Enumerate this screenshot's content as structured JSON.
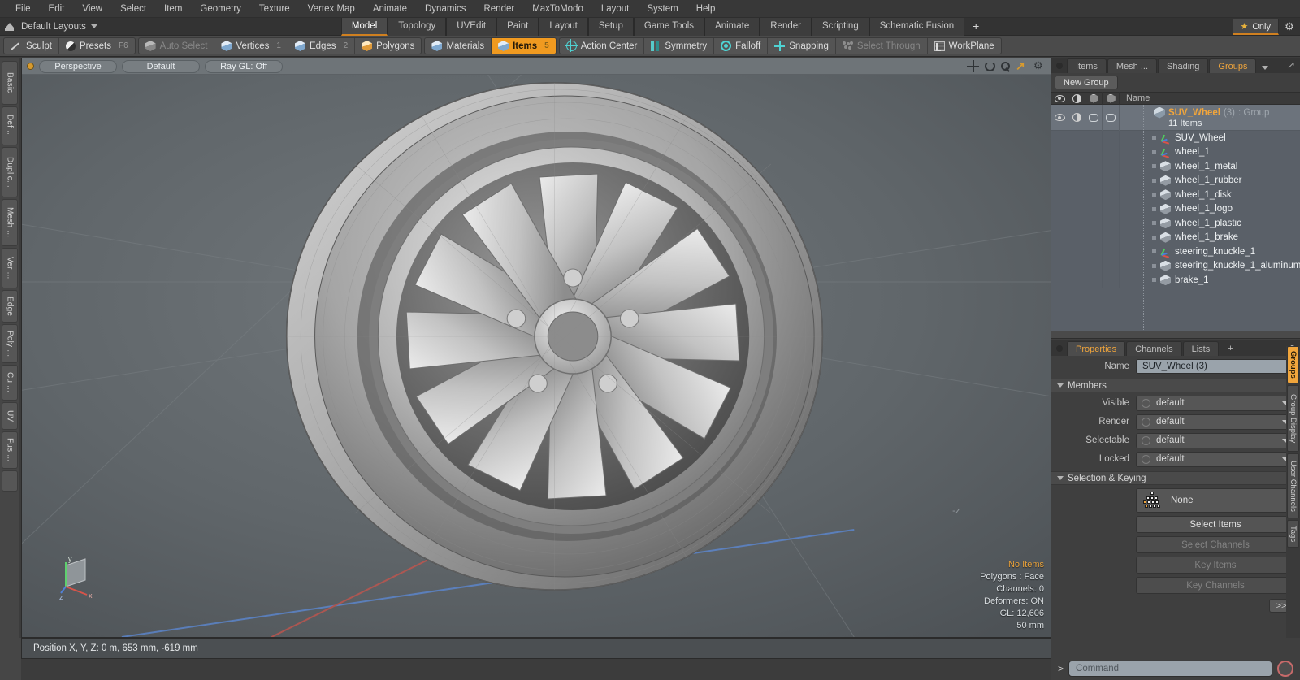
{
  "menu": {
    "items": [
      "File",
      "Edit",
      "View",
      "Select",
      "Item",
      "Geometry",
      "Texture",
      "Vertex Map",
      "Animate",
      "Dynamics",
      "Render",
      "MaxToModo",
      "Layout",
      "System",
      "Help"
    ]
  },
  "layout_row": {
    "home_icon": "home-icon",
    "layout_name": "Default Layouts",
    "tabs": [
      "Model",
      "Topology",
      "UVEdit",
      "Paint",
      "Layout",
      "Setup",
      "Game Tools",
      "Animate",
      "Render",
      "Scripting",
      "Schematic Fusion"
    ],
    "active_tab": "Model",
    "plus_label": "+",
    "only_label": "Only",
    "star_icon": "star-icon",
    "gear_icon": "gear-icon",
    "accent_color": "#d08020"
  },
  "modebar": {
    "sculpt": "Sculpt",
    "presets": "Presets",
    "presets_shortcut": "F6",
    "auto_select": "Auto Select",
    "vertices": "Vertices",
    "vertices_num": "1",
    "edges": "Edges",
    "edges_num": "2",
    "polygons": "Polygons",
    "materials": "Materials",
    "items": "Items",
    "items_num": "5",
    "action_center": "Action Center",
    "symmetry": "Symmetry",
    "falloff": "Falloff",
    "snapping": "Snapping",
    "select_through": "Select Through",
    "workplane": "WorkPlane",
    "active_color": "#f09a20"
  },
  "left_tabs": [
    "Basic",
    "Def ...",
    "Duplic...",
    "Mesh ...",
    "Ver ...",
    "Edge",
    "Poly ...",
    "Cu ...",
    "UV",
    "Fus ..."
  ],
  "viewport": {
    "projection": "Perspective",
    "shading": "Default",
    "raygl": "Ray GL: Off",
    "icons": [
      "move-icon",
      "rotate-icon",
      "zoom-icon",
      "fit-icon",
      "viewport-gear-icon"
    ],
    "stats": {
      "no_items": "No Items",
      "polygons": "Polygons : Face",
      "channels": "Channels: 0",
      "deformers": "Deformers: ON",
      "gl": "GL: 12,606",
      "scale": "50 mm"
    },
    "axis_labels": {
      "x": "x",
      "y": "y",
      "z": "z"
    },
    "origin_marker": "-z"
  },
  "right_panel": {
    "tabs": [
      "Items",
      "Mesh ...",
      "Shading",
      "Groups"
    ],
    "active_tab": "Groups",
    "new_group_button": "New Group",
    "list_columns": [
      "eye-icon",
      "shading-icon",
      "wireframe-icon",
      "render-icon",
      "Name"
    ],
    "name_column": "Name",
    "group": {
      "icon": "group-icon",
      "name": "SUV_Wheel",
      "count": "(3)",
      "type": ": Group",
      "subtitle": "11 Items"
    },
    "items": [
      {
        "icon": "locator-icon",
        "label": "SUV_Wheel"
      },
      {
        "icon": "locator-icon",
        "label": "wheel_1"
      },
      {
        "icon": "mesh-icon",
        "label": "wheel_1_metal"
      },
      {
        "icon": "mesh-icon",
        "label": "wheel_1_rubber"
      },
      {
        "icon": "mesh-icon",
        "label": "wheel_1_disk"
      },
      {
        "icon": "mesh-icon",
        "label": "wheel_1_logo"
      },
      {
        "icon": "mesh-icon",
        "label": "wheel_1_plastic"
      },
      {
        "icon": "mesh-icon",
        "label": "wheel_1_brake"
      },
      {
        "icon": "locator-icon",
        "label": "steering_knuckle_1"
      },
      {
        "icon": "mesh-icon",
        "label": "steering_knuckle_1_aluminum"
      },
      {
        "icon": "mesh-icon",
        "label": "brake_1"
      }
    ]
  },
  "properties": {
    "tabs": [
      "Properties",
      "Channels",
      "Lists"
    ],
    "active_tab": "Properties",
    "plus_label": "+",
    "name_label": "Name",
    "name_value": "SUV_Wheel (3)",
    "members_section": "Members",
    "fields": [
      {
        "label": "Visible",
        "value": "default"
      },
      {
        "label": "Render",
        "value": "default"
      },
      {
        "label": "Selectable",
        "value": "default"
      },
      {
        "label": "Locked",
        "value": "default"
      }
    ],
    "selection_section": "Selection & Keying",
    "selection_set": "None",
    "buttons": [
      {
        "label": "Select Items",
        "enabled": true
      },
      {
        "label": "Select Channels",
        "enabled": false
      },
      {
        "label": "Key Items",
        "enabled": false
      },
      {
        "label": "Key Channels",
        "enabled": false
      }
    ],
    "more_button": ">>"
  },
  "right_vtabs": [
    {
      "label": "Groups",
      "active": true
    },
    {
      "label": "Group Display",
      "active": false
    },
    {
      "label": "User Channels",
      "active": false
    },
    {
      "label": "Tags",
      "active": false
    }
  ],
  "statusbar": {
    "position_text": "Position X, Y, Z:   0 m, 653 mm, -619 mm"
  },
  "command_bar": {
    "prompt": ">",
    "placeholder": "Command",
    "record_icon": "record-icon"
  }
}
